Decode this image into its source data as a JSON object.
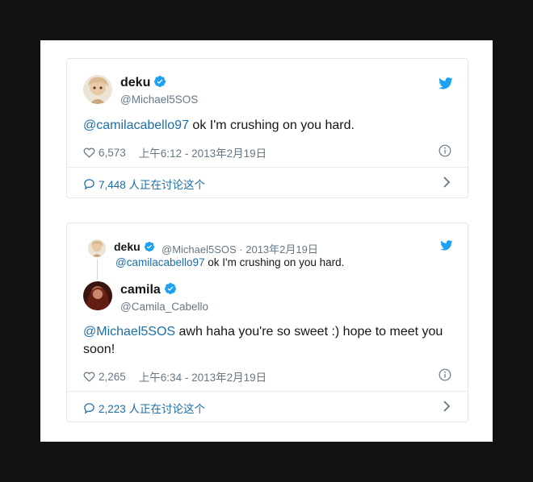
{
  "tweet1": {
    "name": "deku",
    "handle": "@Michael5SOS",
    "mention": "@camilacabello97",
    "text": " ok I'm crushing on you hard.",
    "likes": "6,573",
    "timestamp": "上午6:12 - 2013年2月19日",
    "discussion": "7,448 人正在讨论这个"
  },
  "tweet2": {
    "quoted": {
      "name": "deku",
      "meta": "@Michael5SOS · 2013年2月19日",
      "mention": "@camilacabello97",
      "text": " ok I'm crushing on you hard."
    },
    "name": "camila",
    "handle": "@Camila_Cabello",
    "mention": "@Michael5SOS",
    "text_line1": " awh haha you're so sweet :) hope to meet you",
    "text_line2": "soon!",
    "likes": "2,265",
    "timestamp": "上午6:34 - 2013年2月19日",
    "discussion": "2,223 人正在讨论这个"
  },
  "colors": {
    "twitter_blue": "#1da1f2",
    "link": "#1b6ea8",
    "muted": "#657786",
    "background": "#121210"
  },
  "icons": [
    "twitter-bird-icon",
    "verified-badge-icon",
    "heart-icon",
    "info-icon",
    "comment-bubble-icon",
    "chevron-right-icon"
  ]
}
